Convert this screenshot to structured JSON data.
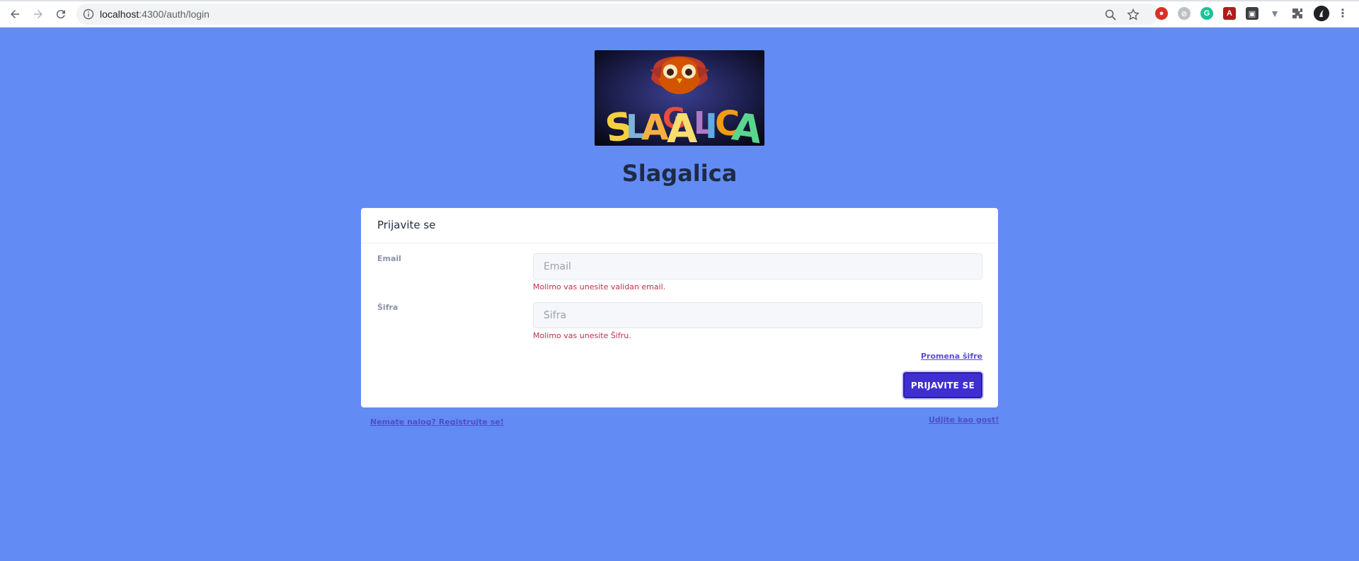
{
  "browser": {
    "url_host": "localhost",
    "url_rest": ":4300/auth/login",
    "icons": [
      "back-arrow-icon",
      "forward-arrow-icon",
      "reload-icon",
      "info-icon",
      "zoom-icon",
      "star-icon",
      "extensions-icon",
      "profile-avatar",
      "menu-dots-icon"
    ]
  },
  "logo": {
    "text": "SLAGALICA"
  },
  "page": {
    "title": "Slagalica"
  },
  "card": {
    "header": "Prijavite se",
    "email_label": "Email",
    "email_placeholder": "Email",
    "email_error": "Molimo vas unesite validan email.",
    "password_label": "Šifra",
    "password_placeholder": "Šifra",
    "password_error": "Molimo vas unesite Šifru.",
    "forgot_link": "Promena šifre",
    "login_button": "PRIJAVITE SE"
  },
  "footer_links": {
    "register": "Nemate nalog? Registrujte se!",
    "guest": "Udjite kao gost!"
  },
  "colors": {
    "background": "#628bf4",
    "primary_button": "#3f2fd1",
    "error": "#c0304a",
    "link": "#5a4fd6"
  }
}
